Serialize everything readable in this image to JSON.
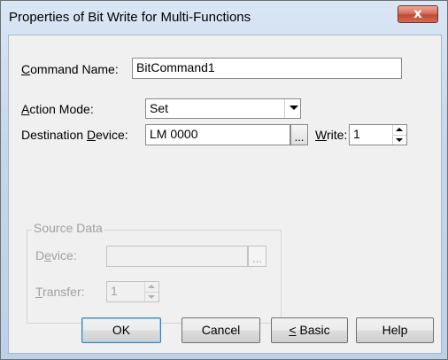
{
  "window": {
    "title": "Properties of Bit Write for Multi-Functions",
    "close_glyph": "x"
  },
  "command_name": {
    "label_mnemonic": "C",
    "label_rest": "ommand Name:",
    "value": "BitCommand1"
  },
  "action_mode": {
    "label_mnemonic": "A",
    "label_rest": "ction Mode:",
    "value": "Set"
  },
  "destination": {
    "label_pre": "Destination ",
    "label_mnemonic": "D",
    "label_rest": "evice:",
    "value": "LM 0000",
    "browse_label": "..."
  },
  "write": {
    "label_mnemonic": "W",
    "label_rest": "rite:",
    "value": "1"
  },
  "source_data": {
    "title": "Source Data",
    "device": {
      "label_pre": "D",
      "label_mnemonic": "e",
      "label_rest": "vice:",
      "value": "",
      "browse_label": "..."
    },
    "transfer": {
      "label_mnemonic": "T",
      "label_rest": "ransfer:",
      "value": "1"
    }
  },
  "buttons": {
    "ok": "OK",
    "cancel": "Cancel",
    "basic_mnemonic": "<",
    "basic_rest": " Basic",
    "help": "Help"
  }
}
